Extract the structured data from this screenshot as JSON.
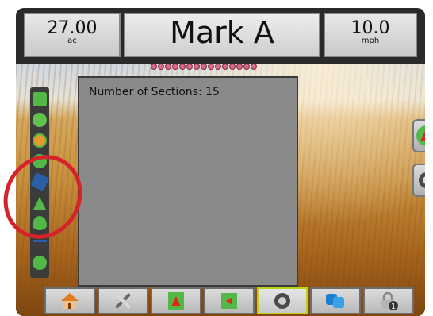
{
  "top_bar": {
    "area": {
      "value": "27.00",
      "unit": "ac"
    },
    "title": "Mark A",
    "speed": {
      "value": "10.0",
      "unit": "mph"
    }
  },
  "boom_sections": {
    "count": 15
  },
  "sections_panel": {
    "label": "Number of Sections: 15"
  },
  "left_rail": {
    "icons": [
      "boom-status-icon",
      "field-map-icon",
      "guidance-icon",
      "gps-icon",
      "tilt-icon",
      "marker-icon",
      "product-droplet-icon",
      "divider",
      "link-icon"
    ]
  },
  "right_buttons": [
    {
      "name": "navigation-arrow-icon"
    },
    {
      "name": "camera-icon"
    }
  ],
  "bottom_tabs": [
    {
      "name": "home-icon"
    },
    {
      "name": "tools-icon"
    },
    {
      "name": "vehicle-view-icon"
    },
    {
      "name": "field-view-icon"
    },
    {
      "name": "camera-tab-icon",
      "active": true
    },
    {
      "name": "data-transfer-icon"
    },
    {
      "name": "lock-icon",
      "badge": "1"
    }
  ],
  "colors": {
    "accent_green": "#52b848",
    "highlight_red": "#d5232a",
    "active_tab": "#bcd21a"
  }
}
